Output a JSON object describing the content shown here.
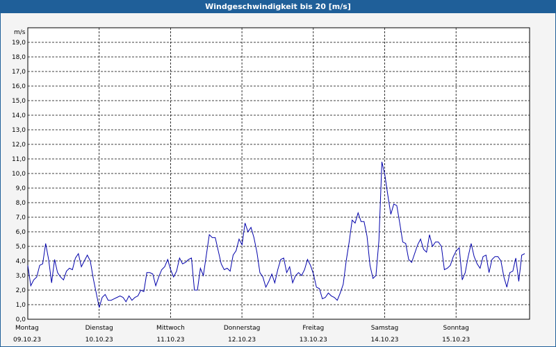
{
  "title": "Windgeschwindigkeit bis 20 [m/s]",
  "chart_data": {
    "type": "line",
    "title": "Windgeschwindigkeit bis 20 [m/s]",
    "ylabel": "m/s",
    "ylim": [
      0,
      20
    ],
    "y_ticks": [
      "0,0",
      "1,0",
      "2,0",
      "3,0",
      "4,0",
      "5,0",
      "6,0",
      "7,0",
      "8,0",
      "9,0",
      "10,0",
      "11,0",
      "12,0",
      "13,0",
      "14,0",
      "15,0",
      "16,0",
      "17,0",
      "18,0",
      "19,0"
    ],
    "days": [
      {
        "name": "Montag",
        "date": "09.10.23"
      },
      {
        "name": "Dienstag",
        "date": "10.10.23"
      },
      {
        "name": "Mittwoch",
        "date": "11.10.23"
      },
      {
        "name": "Donnerstag",
        "date": "12.10.23"
      },
      {
        "name": "Freitag",
        "date": "13.10.23"
      },
      {
        "name": "Samstag",
        "date": "14.10.23"
      },
      {
        "name": "Sonntag",
        "date": "15.10.23"
      }
    ],
    "grid": true,
    "line_color": "#0000aa",
    "series": [
      {
        "values": [
          3.7,
          2.3,
          2.7,
          2.9,
          3.7,
          3.8,
          5.2,
          4.1,
          2.5,
          4.1,
          3.2,
          2.9,
          2.7,
          3.3,
          3.5,
          3.4,
          4.2,
          4.5,
          3.6,
          4.0,
          4.4,
          4.0,
          2.8,
          1.8,
          0.8,
          1.5,
          1.7,
          1.3,
          1.3,
          1.4,
          1.5,
          1.6,
          1.5,
          1.2,
          1.6,
          1.3,
          1.5,
          1.6,
          2.0,
          1.9,
          3.2,
          3.2,
          3.1,
          2.3,
          2.9,
          3.4,
          3.6,
          4.1,
          3.4,
          2.9,
          3.3,
          4.2,
          3.8,
          3.9,
          4.1,
          4.2,
          2.0,
          2.0,
          3.5,
          3.0,
          4.4,
          5.8,
          5.6,
          5.6,
          4.7,
          3.8,
          3.4,
          3.5,
          3.3,
          4.4,
          4.7,
          5.5,
          5.1,
          6.6,
          6.0,
          6.3,
          5.6,
          4.6,
          3.2,
          2.9,
          2.2,
          2.6,
          3.1,
          2.5,
          3.4,
          4.1,
          4.2,
          3.2,
          3.6,
          2.5,
          3.0,
          3.2,
          3.0,
          3.4,
          4.1,
          3.7,
          3.1,
          2.2,
          2.1,
          1.4,
          1.5,
          1.8,
          1.6,
          1.5,
          1.3,
          1.8,
          2.4,
          4.0,
          5.3,
          6.8,
          6.6,
          7.3,
          6.7,
          6.7,
          5.7,
          3.7,
          2.8,
          3.0,
          5.4,
          10.8,
          9.9,
          8.5,
          7.2,
          7.9,
          7.8,
          6.6,
          5.3,
          5.2,
          4.1,
          3.9,
          4.5,
          5.1,
          5.5,
          4.8,
          4.6,
          5.8,
          5.0,
          5.3,
          5.3,
          5.0,
          3.4,
          3.5,
          3.7,
          4.3,
          4.7,
          4.9,
          2.7,
          3.2,
          4.3,
          5.2,
          4.3,
          3.8,
          3.5,
          4.3,
          4.4,
          3.2,
          4.1,
          4.3,
          4.3,
          4.0,
          2.9,
          2.2,
          3.2,
          3.3,
          4.2,
          2.6,
          4.4,
          4.5
        ]
      }
    ]
  }
}
